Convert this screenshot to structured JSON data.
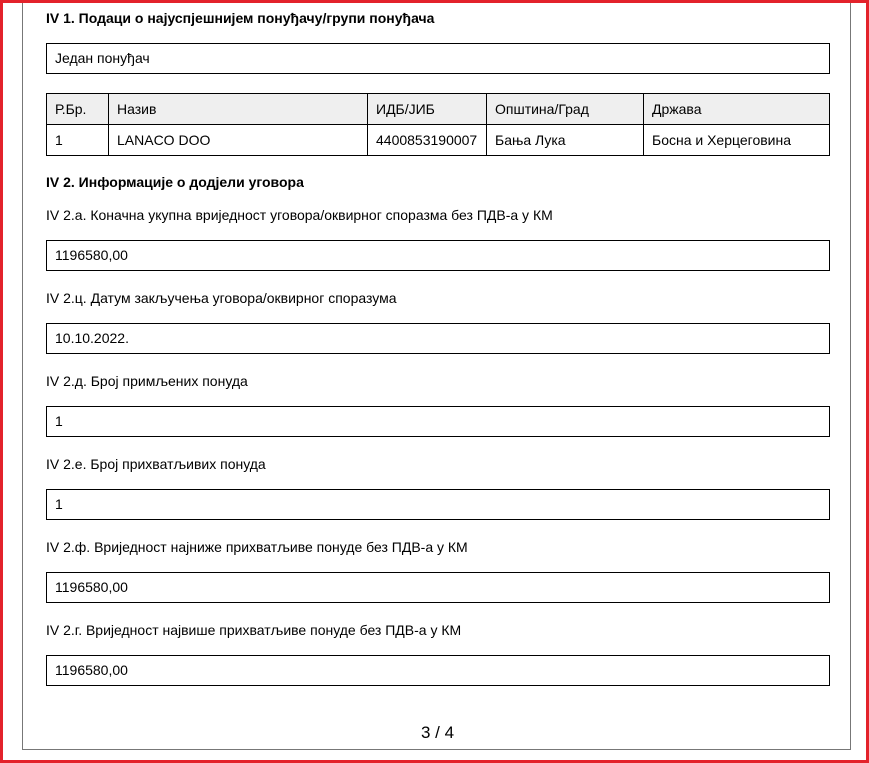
{
  "section_iv1": {
    "heading": "IV 1. Подаци о најуспјешнијем понуђачу/групи понуђача",
    "bidder_type": "Један понуђач",
    "table": {
      "headers": [
        "Р.Бр.",
        "Назив",
        "ИДБ/ЈИБ",
        "Општина/Град",
        "Држава"
      ],
      "rows": [
        [
          "1",
          "LANACO DOO",
          "4400853190007",
          "Бања Лука",
          "Босна и Херцеговина"
        ]
      ]
    }
  },
  "section_iv2": {
    "heading": "IV 2. Информације о додјели уговора",
    "fields": [
      {
        "label": "IV 2.а. Коначна укупна вриједност уговора/оквирног споразма без ПДВ-а у КМ",
        "value": "1196580,00"
      },
      {
        "label": "IV 2.ц. Датум закључења уговора/оквирног споразума",
        "value": "10.10.2022."
      },
      {
        "label": "IV 2.д. Број примљених понуда",
        "value": "1"
      },
      {
        "label": "IV 2.е. Број прихватљивих понуда",
        "value": "1"
      },
      {
        "label": "IV 2.ф. Вриједност најниже прихватљиве понуде без ПДВ-а у КМ",
        "value": "1196580,00"
      },
      {
        "label": "IV 2.г. Вриједност највише прихватљиве понуде без ПДВ-а у КМ",
        "value": "1196580,00"
      }
    ]
  },
  "footer": {
    "page_number": "3 / 4"
  },
  "colors": {
    "frame_border": "#e3222b",
    "table_header_bg": "#efefef"
  }
}
